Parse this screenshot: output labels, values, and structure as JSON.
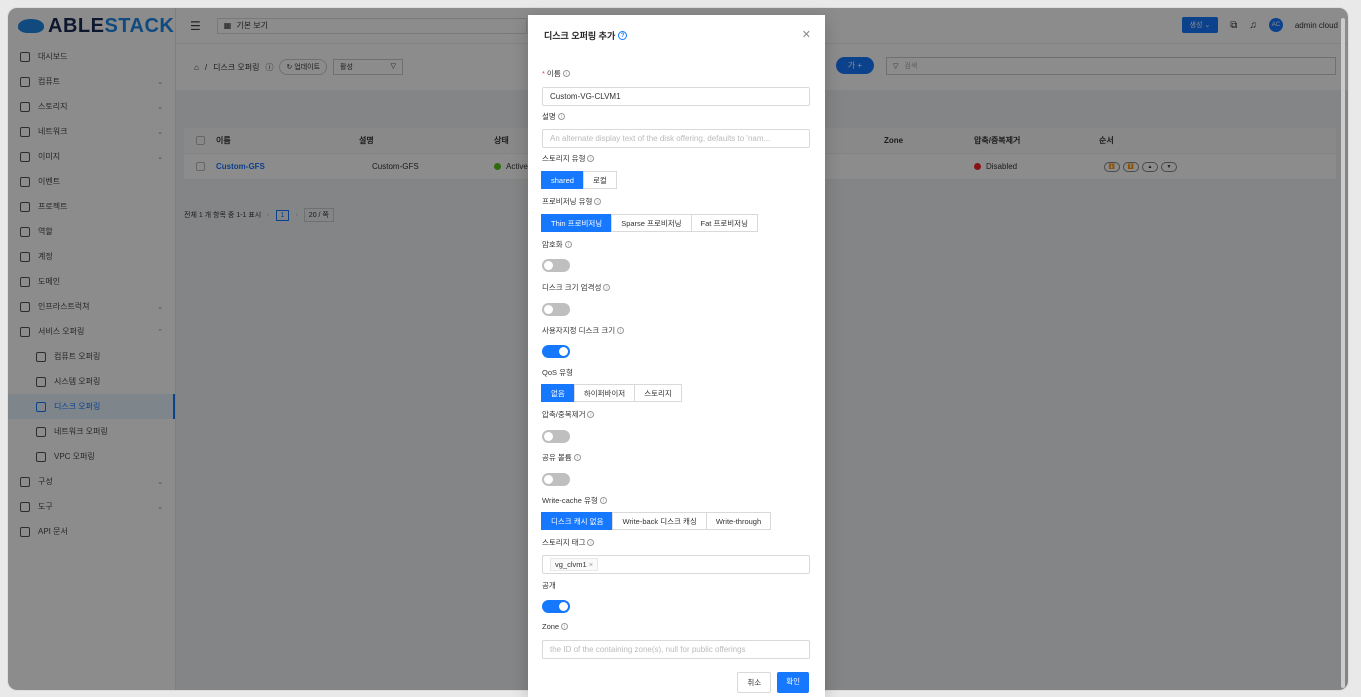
{
  "brand": {
    "a": "ABLE",
    "b": "STACK"
  },
  "sidebar": {
    "items": [
      {
        "label": "대시보드"
      },
      {
        "label": "컴퓨트"
      },
      {
        "label": "스토리지"
      },
      {
        "label": "네트워크"
      },
      {
        "label": "이미지"
      },
      {
        "label": "이벤트"
      },
      {
        "label": "프로젝트"
      },
      {
        "label": "역할"
      },
      {
        "label": "계정"
      },
      {
        "label": "도메인"
      },
      {
        "label": "인프라스트럭쳐"
      },
      {
        "label": "서비스 오퍼링"
      },
      {
        "label": "컴퓨트 오퍼링"
      },
      {
        "label": "시스템 오퍼링"
      },
      {
        "label": "디스크 오퍼링"
      },
      {
        "label": "네트워크 오퍼링"
      },
      {
        "label": "VPC 오퍼링"
      },
      {
        "label": "구성"
      },
      {
        "label": "도구"
      },
      {
        "label": "API 문서"
      }
    ]
  },
  "topbar": {
    "view": "기본 보기",
    "create": "생성",
    "user": "admin cloud",
    "avatar": "AC"
  },
  "list": {
    "crumb": "디스크 오퍼링",
    "update": "업데이트",
    "filter": "활성",
    "add": "가 +",
    "search_placeholder": "검색",
    "headers": {
      "name": "이름",
      "desc": "설명",
      "state": "상태",
      "zone": "Zone",
      "compress": "압축/중복제거",
      "order": "순서"
    },
    "row": {
      "name": "Custom-GFS",
      "desc": "Custom-GFS",
      "state": "Active",
      "compress": "Disabled"
    },
    "pager": "전체 1 개 항목 중 1-1 표시",
    "page": "1",
    "pagesize": "20 / 쪽"
  },
  "modal": {
    "title": "디스크 오퍼링 추가",
    "name_label": "이름",
    "name_value": "Custom-VG-CLVM1",
    "desc_label": "설명",
    "desc_placeholder": "An alternate display text of the disk offering, defaults to 'nam...",
    "storage_type_label": "스토리지 유형",
    "storage_type": [
      "shared",
      "로컬"
    ],
    "prov_label": "프로비저닝 유형",
    "prov": [
      "Thin 프로비저닝",
      "Sparse 프로비저닝",
      "Fat 프로비저닝"
    ],
    "encrypt_label": "암호화",
    "strict_label": "디스크 크기 엄격성",
    "custom_size_label": "사용자지정 디스크 크기",
    "qos_label": "QoS 유형",
    "qos": [
      "없음",
      "하이퍼바이저",
      "스토리지"
    ],
    "dedup_label": "압축/중복제거",
    "shared_label": "공유 볼륨",
    "cache_label": "Write-cache 유형",
    "cache": [
      "디스크 캐시 없음",
      "Write-back 디스크 캐싱",
      "Write-through"
    ],
    "tag_label": "스토리지 태그",
    "tag_value": "vg_clvm1",
    "public_label": "공개",
    "zone_label": "Zone",
    "zone_placeholder": "the ID of the containing zone(s), null for public offerings",
    "cancel": "취소",
    "ok": "확인"
  }
}
